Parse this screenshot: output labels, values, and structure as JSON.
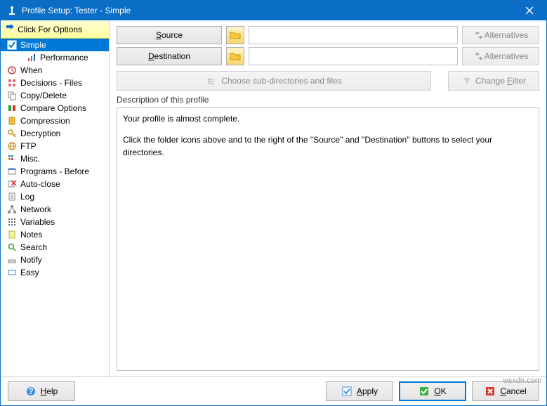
{
  "titlebar": {
    "title": "Profile Setup: Tester - Simple"
  },
  "sidebar": {
    "click_options": "Click For Options",
    "items": [
      {
        "label": "Simple"
      },
      {
        "label": "Performance"
      },
      {
        "label": "When"
      },
      {
        "label": "Decisions - Files"
      },
      {
        "label": "Copy/Delete"
      },
      {
        "label": "Compare Options"
      },
      {
        "label": "Compression"
      },
      {
        "label": "Decryption"
      },
      {
        "label": "FTP"
      },
      {
        "label": "Misc."
      },
      {
        "label": "Programs - Before"
      },
      {
        "label": "Auto-close"
      },
      {
        "label": "Log"
      },
      {
        "label": "Network"
      },
      {
        "label": "Variables"
      },
      {
        "label": "Notes"
      },
      {
        "label": "Search"
      },
      {
        "label": "Notify"
      },
      {
        "label": "Easy"
      }
    ]
  },
  "main": {
    "source_label": "Source",
    "destination_label": "Destination",
    "source_value": "",
    "destination_value": "",
    "alternatives_label": "Alternatives",
    "choose_sub_label": "Choose sub-directories and files",
    "change_filter_label": "Change Filter",
    "desc_title": "Description of this profile",
    "desc_line1": "Your profile is almost complete.",
    "desc_line2": "Click the folder icons above and to the right of the \"Source\" and \"Destination\" buttons to select your directories."
  },
  "footer": {
    "help": "Help",
    "apply": "Apply",
    "ok": "OK",
    "cancel": "Cancel"
  },
  "watermark": "wsxdn.com"
}
